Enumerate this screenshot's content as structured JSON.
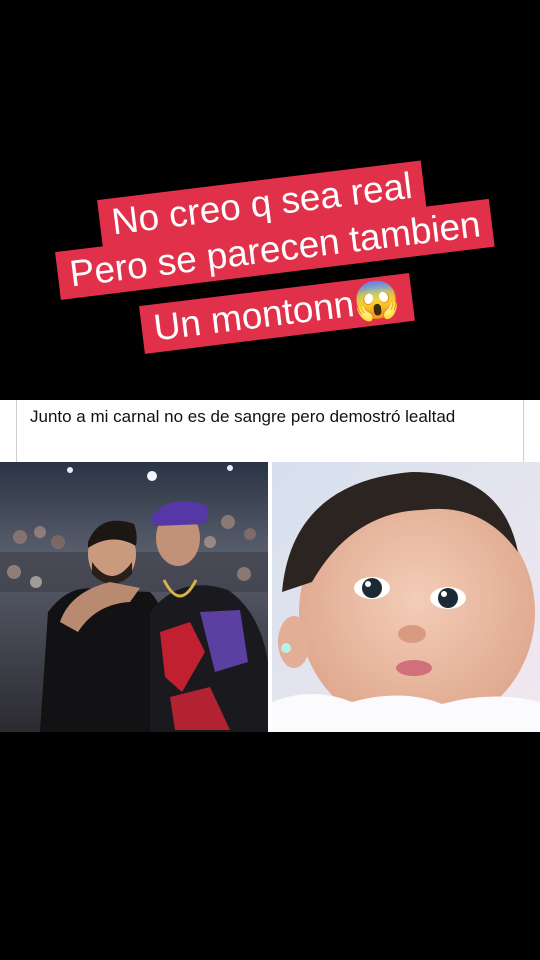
{
  "caption": {
    "line1": "No creo q sea real",
    "line2": "Pero se parecen tambien",
    "line3": "Un montonn😱"
  },
  "post": {
    "text": "Junto a mi carnal no es de sangre pero demostró lealtad"
  },
  "colors": {
    "caption_bg": "#e1314a",
    "page_bg": "#000000"
  }
}
